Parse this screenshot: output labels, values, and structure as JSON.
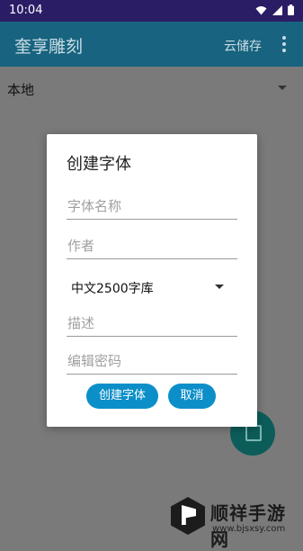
{
  "status_bar": {
    "time": "10:04",
    "icons": [
      "wifi-icon",
      "signal-icon",
      "battery-icon"
    ]
  },
  "app_bar": {
    "title": "奎享雕刻",
    "cloud_label": "云储存",
    "more_icon": "more-vert-icon"
  },
  "location_selector": {
    "value": "本地"
  },
  "dialog": {
    "title": "创建字体",
    "name_placeholder": "字体名称",
    "author_placeholder": "作者",
    "charset_selected": "中文2500字库",
    "description_placeholder": "描述",
    "password_placeholder": "编辑密码",
    "create_button": "创建字体",
    "cancel_button": "取消"
  },
  "fab": {
    "icon": "add-file-icon"
  },
  "watermark": {
    "name": "顺祥手游网",
    "url": "www.bjsxsy.com"
  },
  "colors": {
    "status_bar": "#2a1d66",
    "app_bar": "#18637f",
    "accent": "#0c8fc9",
    "fab": "#0c5d5a"
  }
}
